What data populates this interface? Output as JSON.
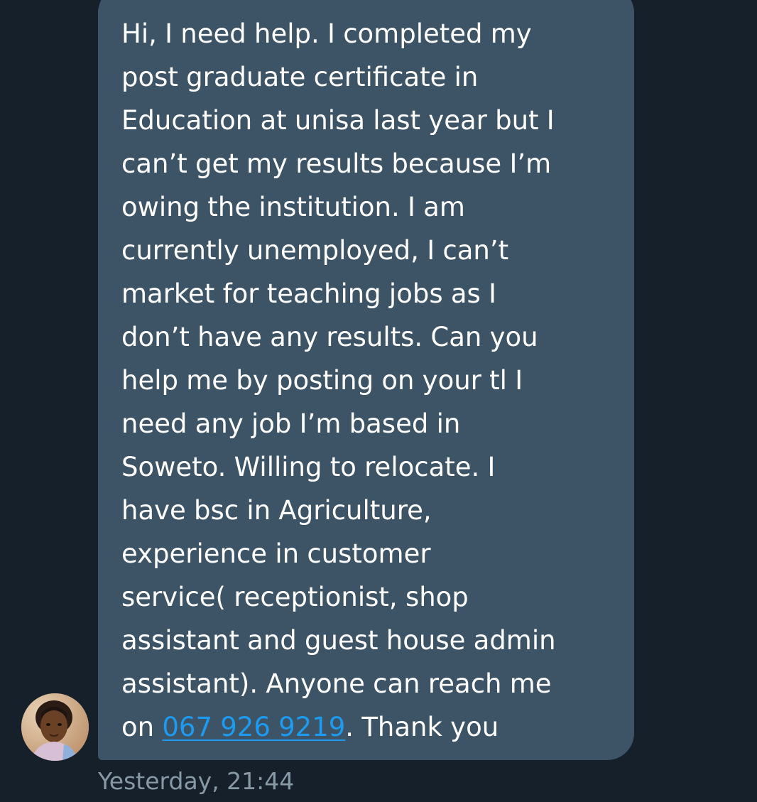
{
  "conversation": {
    "message": {
      "text_before_link": "Hi, I need help. I completed my\npost graduate certificate in\nEducation at unisa last year but I\ncan’t get my results because I’m\nowing the institution. I am\ncurrently unemployed, I can’t\nmarket for teaching jobs as I\ndon’t have any results. Can you\nhelp me by posting on your tl I\nneed any job I’m based in\nSoweto. Willing to relocate. I\nhave bsc in Agriculture,\nexperience in customer\nservice( receptionist, shop\nassistant and guest house admin\nassistant). Anyone can reach me\non ",
      "phone_link": "067 926 9219",
      "text_after_link": ". Thank you",
      "timestamp": "Yesterday, 21:44"
    },
    "sender": {
      "avatar_icon": "profile-photo-icon"
    }
  },
  "colors": {
    "background": "#15202b",
    "bubble": "#3d5466",
    "message_text": "#ffffff",
    "link": "#1d9bf0",
    "timestamp": "#8899a6"
  }
}
